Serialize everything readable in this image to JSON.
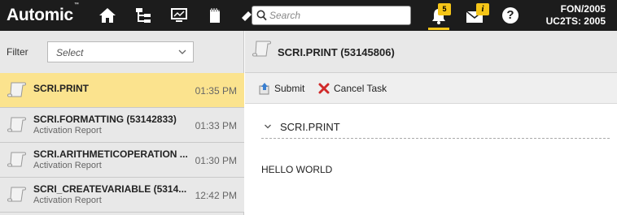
{
  "app": {
    "logo": "Automic",
    "logo_mark": "™"
  },
  "topbar": {
    "search_placeholder": "Search",
    "notifications_count": "5",
    "messages_badge": "i",
    "help_label": "?",
    "user_line1": "FON/2005",
    "user_line2": "UC2TS: 2005",
    "icons": [
      "home-icon",
      "hierarchy-icon",
      "monitor-icon",
      "cards-icon",
      "wrench-icon",
      "bell-icon",
      "envelope-icon",
      "help-icon"
    ],
    "accent_color": "#f5c518"
  },
  "filter": {
    "label": "Filter",
    "selected": "Select"
  },
  "tasks": [
    {
      "title": "SCRI.PRINT",
      "subtitle": "",
      "time": "01:35 PM",
      "selected": true
    },
    {
      "title": "SCRI.FORMATTING (53142833)",
      "subtitle": "Activation Report",
      "time": "01:33 PM",
      "selected": false
    },
    {
      "title": "SCRI.ARITHMETICOPERATION ...",
      "subtitle": "Activation Report",
      "time": "01:30 PM",
      "selected": false
    },
    {
      "title": "SCRI_CREATEVARIABLE (5314...",
      "subtitle": "Activation Report",
      "time": "12:42 PM",
      "selected": false
    }
  ],
  "detail": {
    "title": "SCRI.PRINT (53145806)",
    "toolbar": {
      "submit_label": "Submit",
      "cancel_label": "Cancel Task"
    },
    "section_title": "SCRI.PRINT",
    "output_text": "HELLO WORLD"
  }
}
